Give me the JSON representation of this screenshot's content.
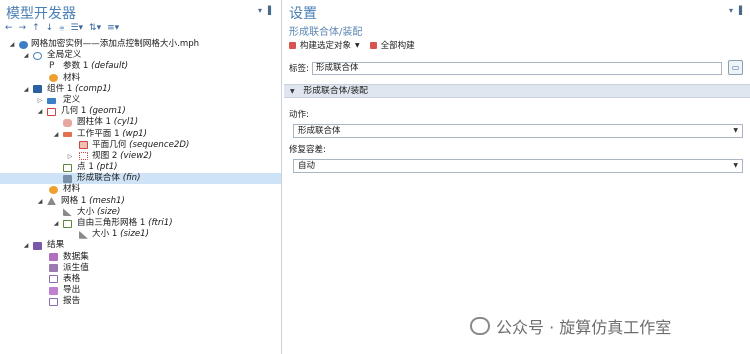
{
  "left_panel": {
    "title": "模型开发器",
    "toolbar_icons": [
      "arrow-left-icon",
      "arrow-right-icon",
      "arrow-up-icon",
      "arrow-down-icon",
      "filter-icon",
      "expand-icon",
      "sort-icon",
      "list-icon"
    ]
  },
  "tree": {
    "root": "网格加密实例——添加点控制网格大小.mph",
    "global_defs": "全局定义",
    "param_name": "参数 1",
    "param_tag": "(default)",
    "materials_global": "材料",
    "component_name": "组件 1",
    "component_tag": "(comp1)",
    "definitions": "定义",
    "geometry_name": "几何 1",
    "geometry_tag": "(geom1)",
    "cylinder_name": "圆柱体 1",
    "cylinder_tag": "(cyl1)",
    "workplane_name": "工作平面 1",
    "workplane_tag": "(wp1)",
    "planegeom_name": "平面几何",
    "planegeom_tag": "(sequence2D)",
    "view_name": "视图 2",
    "view_tag": "(view2)",
    "point_name": "点 1",
    "point_tag": "(pt1)",
    "union_name": "形成联合体",
    "union_tag": "(fin)",
    "materials": "材料",
    "mesh_name": "网格 1",
    "mesh_tag": "(mesh1)",
    "size_name": "大小",
    "size_tag": "(size)",
    "ftri_name": "自由三角形网格 1",
    "ftri_tag": "(ftri1)",
    "size1_name": "大小 1",
    "size1_tag": "(size1)",
    "results": "结果",
    "datasets": "数据集",
    "derived": "派生值",
    "tables": "表格",
    "export": "导出",
    "report": "报告"
  },
  "right_panel": {
    "title": "设置",
    "subtitle": "形成联合体/装配",
    "build_selected": "构建选定对象",
    "build_all": "全部构建",
    "label_caption": "标签:",
    "label_value": "形成联合体",
    "section_title": "形成联合体/装配",
    "action_caption": "动作:",
    "action_value": "形成联合体",
    "repair_caption": "修复容差:",
    "repair_value": "自动"
  },
  "watermark": "公众号 · 旋算仿真工作室",
  "colors": {
    "accent_title": "#4a7fb5",
    "selected_row": "#cfe3f7",
    "section_bg": "#dfe6ef"
  }
}
